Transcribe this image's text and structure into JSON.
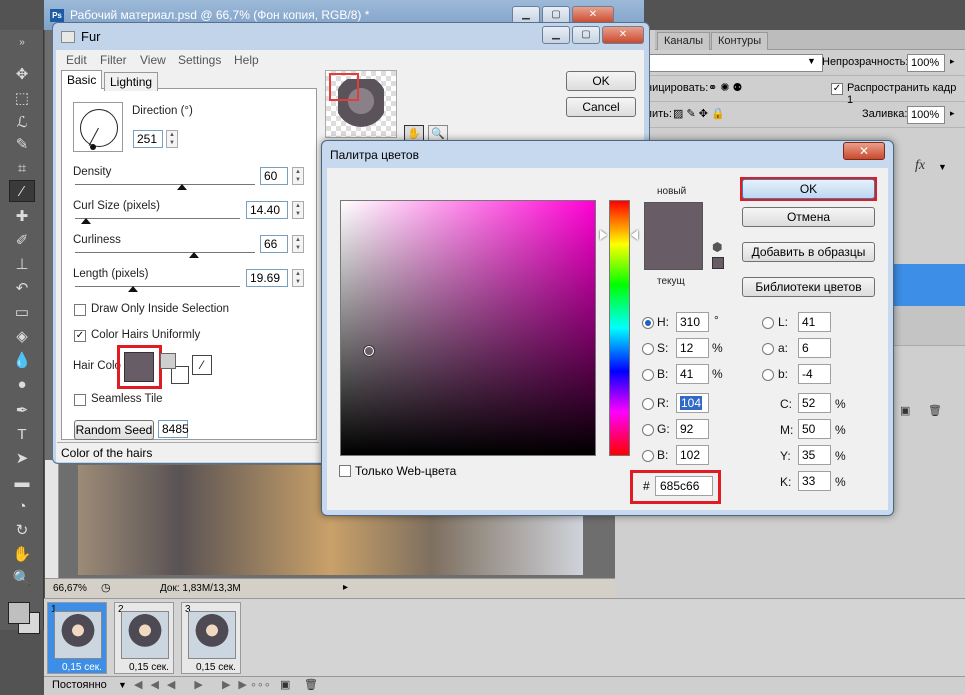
{
  "photoshop": {
    "doc_title": "Рабочий материал.psd @ 66,7% (Фон копия, RGB/8) *",
    "logo_text": "Ps",
    "status_zoom": "66,67%",
    "status_doc": "Док: 1,83M/13,3M",
    "panel_tabs": [
      "Каналы",
      "Контуры"
    ],
    "opacity_label": "Непрозрачность:",
    "opacity_value": "100%",
    "fill_label": "Заливка:",
    "fill_value": "100%",
    "unify_label": "ницировать:",
    "lock_label": "пить:",
    "propagate_label": "Распространить кадр 1",
    "blend_mode_fragment": "ные",
    "fx_label": "fx",
    "frames": [
      {
        "num": "1",
        "duration": "0,15 сек."
      },
      {
        "num": "2",
        "duration": "0,15 сек."
      },
      {
        "num": "3",
        "duration": "0,15 сек."
      }
    ],
    "loop_label": "Постоянно"
  },
  "fur": {
    "title": "Fur",
    "menu": [
      "Edit",
      "Filter",
      "View",
      "Settings",
      "Help"
    ],
    "tabs": [
      "Basic",
      "Lighting"
    ],
    "direction_label": "Direction (°)",
    "direction_value": "251",
    "density_label": "Density",
    "density_value": "60",
    "curl_label": "Curl Size (pixels)",
    "curl_value": "14.40",
    "curliness_label": "Curliness",
    "curliness_value": "66",
    "length_label": "Length (pixels)",
    "length_value": "19.69",
    "draw_inside_label": "Draw Only Inside Selection",
    "uniform_label": "Color Hairs Uniformly",
    "hair_color_label": "Hair Colo",
    "seamless_label": "Seamless Tile",
    "random_seed_label": "Random Seed",
    "random_seed_value": "8485",
    "status_text": "Color of the hairs",
    "ok_label": "OK",
    "cancel_label": "Cancel"
  },
  "picker": {
    "title": "Палитра цветов",
    "new_label": "новый",
    "current_label": "текущ",
    "ok_label": "OK",
    "cancel_label": "Отмена",
    "add_label": "Добавить в образцы",
    "libraries_label": "Библиотеки цветов",
    "webonly_label": "Только Web-цвета",
    "H": "310",
    "S": "12",
    "Bv": "41",
    "R": "104",
    "G": "92",
    "Bc": "102",
    "L": "41",
    "a": "6",
    "b": "-4",
    "C": "52",
    "M": "50",
    "Y": "35",
    "K": "33",
    "hex": "685c66",
    "labels": {
      "H": "H:",
      "S": "S:",
      "Bv": "B:",
      "R": "R:",
      "G": "G:",
      "Bc": "B:",
      "L": "L:",
      "a": "a:",
      "b": "b:",
      "C": "C:",
      "M": "M:",
      "Y": "Y:",
      "K": "K:"
    },
    "units": {
      "deg": "°",
      "pct": "%"
    },
    "hex_prefix": "#",
    "selected_color": "#685c66"
  }
}
